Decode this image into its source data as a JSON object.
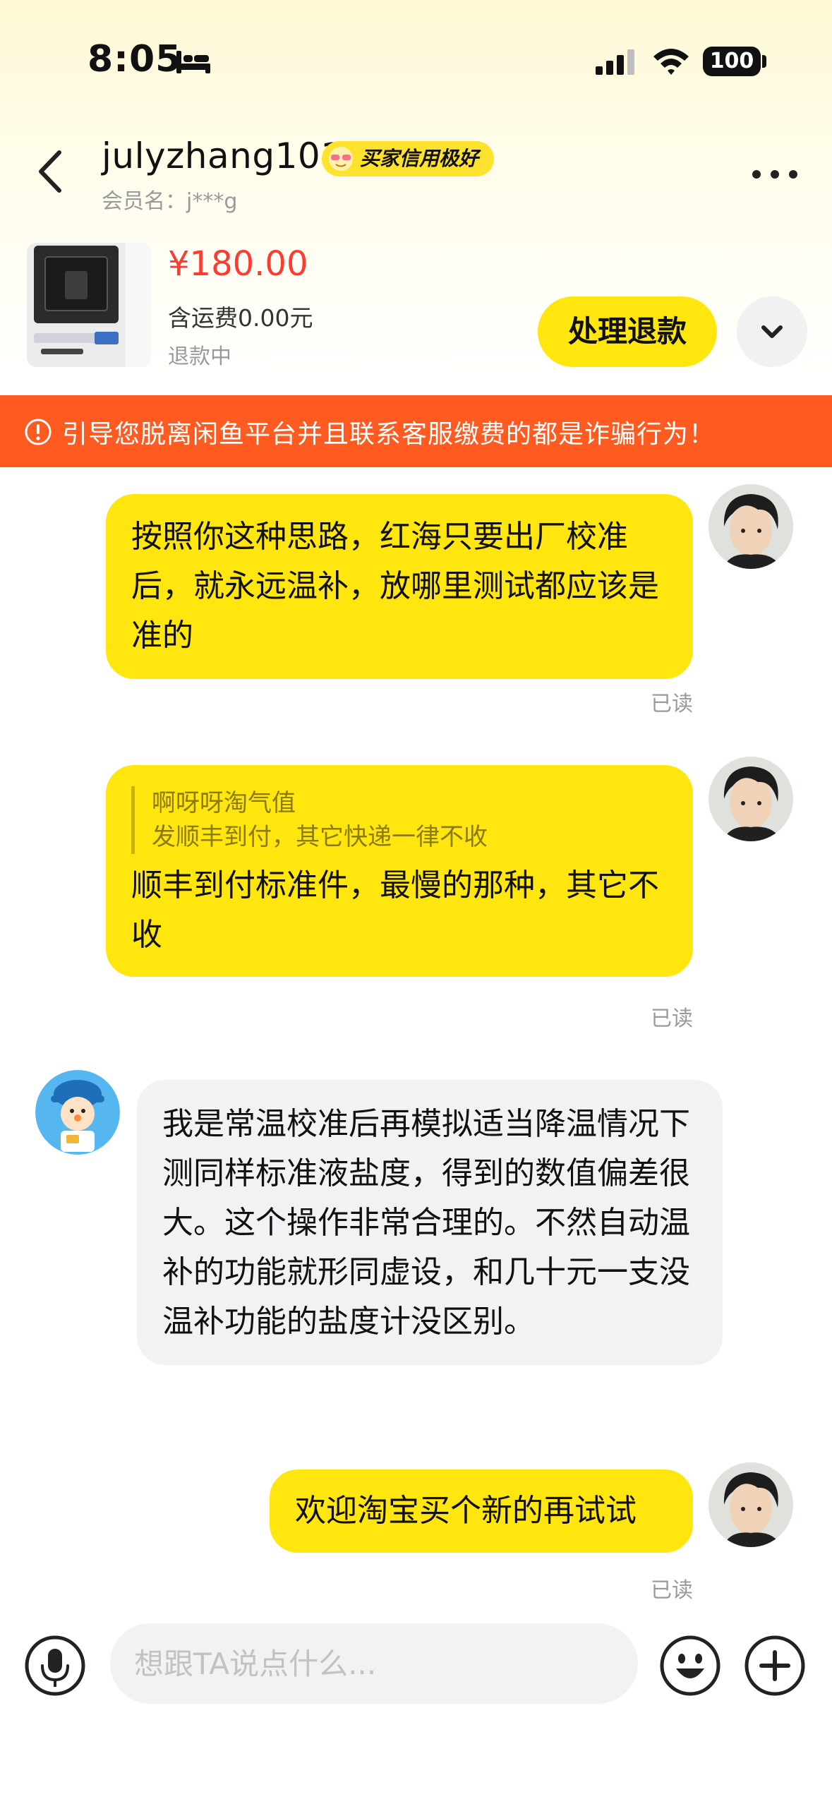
{
  "status_bar": {
    "time": "8:05",
    "battery": "100"
  },
  "header": {
    "user_name": "julyzhang101",
    "credit_badge": "买家信用极好",
    "member_label": "会员名：",
    "member_value": "j***g"
  },
  "order": {
    "price": "¥180.00",
    "shipping": "含运费0.00元",
    "status": "退款中",
    "action_label": "处理退款"
  },
  "warning": {
    "text": "引导您脱离闲鱼平台并且联系客服缴费的都是诈骗行为！"
  },
  "messages": [
    {
      "from": "me",
      "text": "按照你这种思路，红海只要出厂校准后，就永远温补，放哪里测试都应该是准的",
      "read": "已读"
    },
    {
      "from": "me",
      "quote_name": "啊呀呀淘气值",
      "quote_text": "发顺丰到付，其它快递一律不收",
      "text": "顺丰到付标准件，最慢的那种，其它不收",
      "read": "已读"
    },
    {
      "from": "them",
      "text": "我是常温校准后再模拟适当降温情况下测同样标准液盐度，得到的数值偏差很大。这个操作非常合理的。不然自动温补的功能就形同虚设，和几十元一支没温补功能的盐度计没区别。"
    },
    {
      "from": "me",
      "text": "欢迎淘宝买个新的再试试",
      "read": "已读"
    }
  ],
  "input": {
    "placeholder": "想跟TA说点什么..."
  },
  "icons": {
    "back": "chevron-left-icon",
    "more": "more-icon",
    "expand": "chevron-down-icon",
    "warning": "exclamation-circle-icon",
    "mic": "microphone-icon",
    "emoji": "emoji-icon",
    "plus": "plus-icon"
  },
  "colors": {
    "accent": "#ffe60f",
    "price": "#ff3b30",
    "warning": "#ff5a1f"
  }
}
